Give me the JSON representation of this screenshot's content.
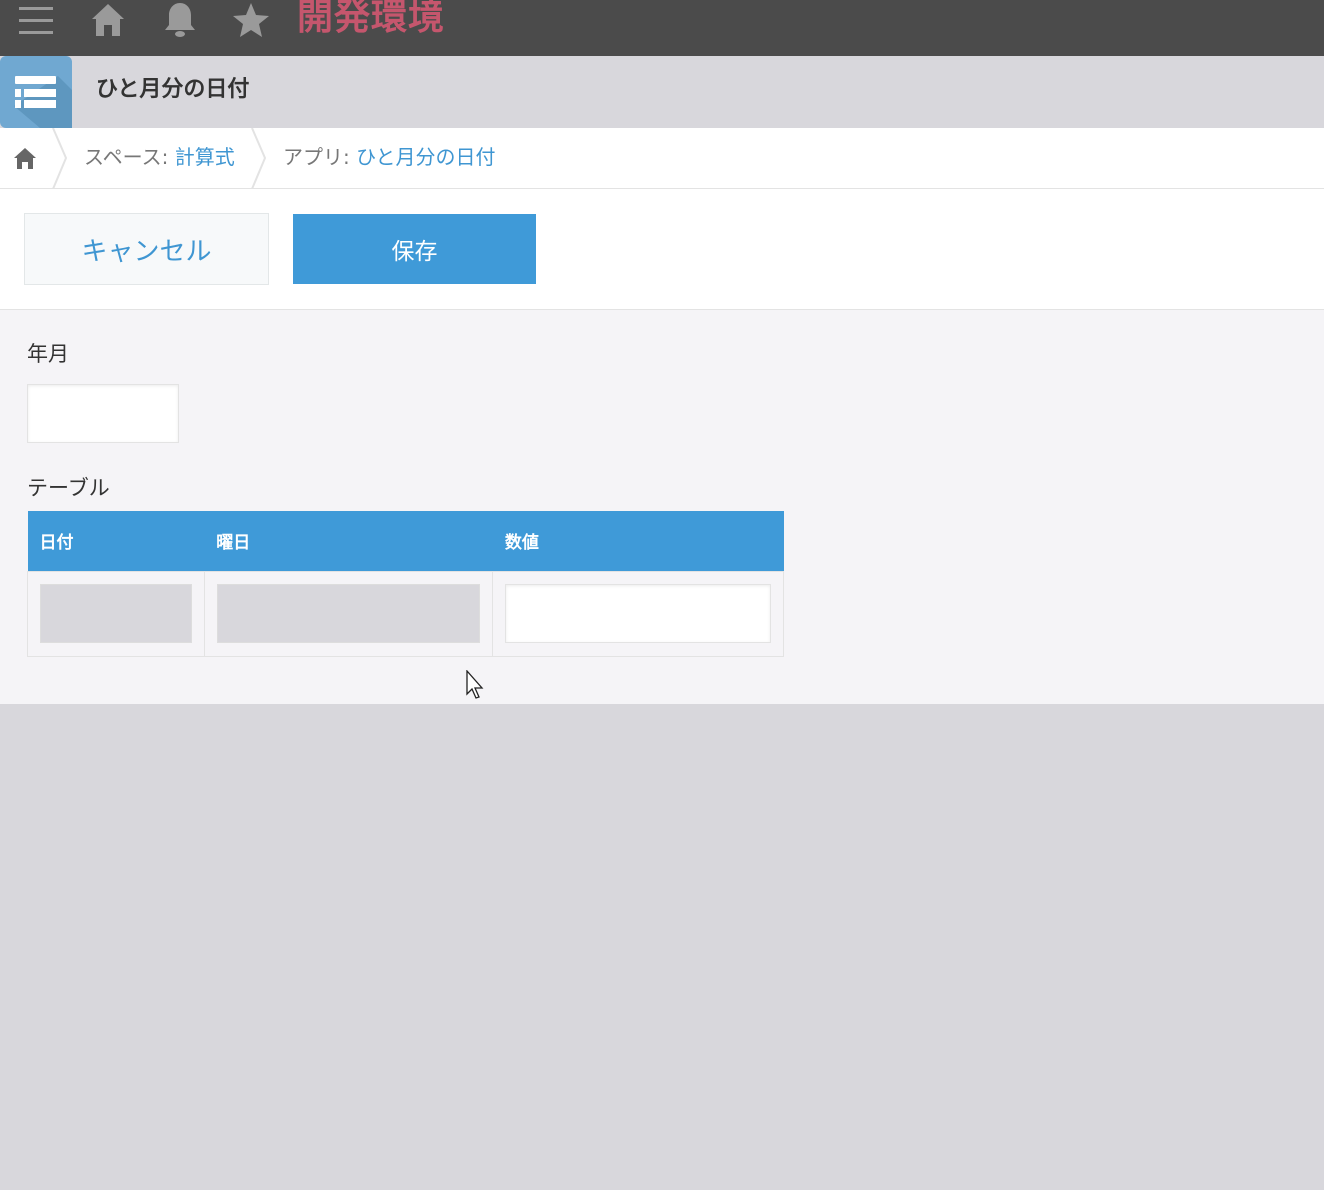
{
  "topbar": {
    "environment_title": "開発環境",
    "title_color": "#c5566d",
    "icons": [
      "menu-icon",
      "home-icon",
      "bell-icon",
      "star-icon"
    ]
  },
  "app": {
    "title": "ひと月分の日付",
    "icon": "app-list-icon",
    "icon_color": "#70a8d1"
  },
  "breadcrumb": {
    "home_icon": "home-icon",
    "space_prefix": "スペース:",
    "space_name": "計算式",
    "app_prefix": "アプリ:",
    "app_name": "ひと月分の日付"
  },
  "toolbar": {
    "cancel_label": "キャンセル",
    "save_label": "保存",
    "accent_color": "#3f9ad8"
  },
  "form": {
    "year_month_label": "年月",
    "year_month_value": "",
    "table_label": "テーブル",
    "table": {
      "columns": [
        "日付",
        "曜日",
        "数値"
      ],
      "rows": [
        {
          "date": "",
          "weekday": "",
          "number": ""
        }
      ]
    }
  }
}
